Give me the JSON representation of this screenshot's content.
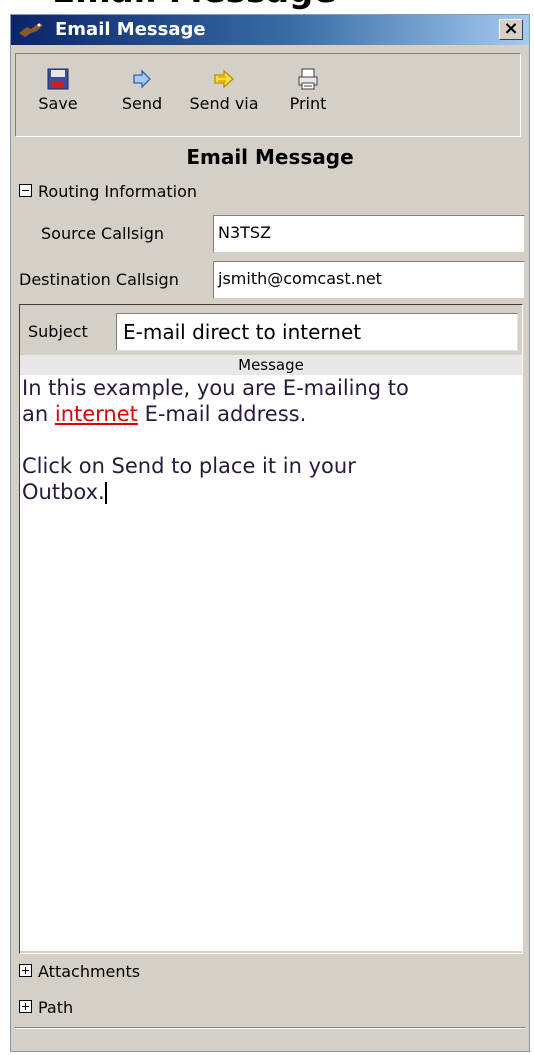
{
  "page": {
    "partial_heading": "Email Message"
  },
  "window": {
    "title": "Email Message",
    "close_label": "×"
  },
  "toolbar": {
    "save_label": "Save",
    "send_label": "Send",
    "send_via_label": "Send via",
    "print_label": "Print"
  },
  "form": {
    "heading": "Email Message",
    "routing_section": "Routing Information",
    "source_label": "Source Callsign",
    "source_value": "N3TSZ",
    "dest_label": "Destination Callsign",
    "dest_value": "jsmith@comcast.net",
    "subject_label": "Subject",
    "subject_value": "E-mail direct to internet",
    "message_header": "Message",
    "message": {
      "line1": "In this example, you are E-mailing to",
      "line2_prefix": "an ",
      "line2_link": "internet",
      "line2_suffix": " E-mail address.",
      "line3": "Click on Send to place it in your",
      "line4": "Outbox."
    },
    "attachments_section": "Attachments",
    "path_section": "Path"
  },
  "icons": {
    "save": "save-disk-icon",
    "send": "send-arrow-icon",
    "send_via": "send-via-arrow-icon",
    "print": "printer-icon",
    "app": "app-bird-icon",
    "close": "close-icon"
  },
  "colors": {
    "titlebar_start": "#0a246a",
    "titlebar_end": "#a6caf0",
    "link": "#e00000",
    "window_bg": "#d4d0c8"
  }
}
